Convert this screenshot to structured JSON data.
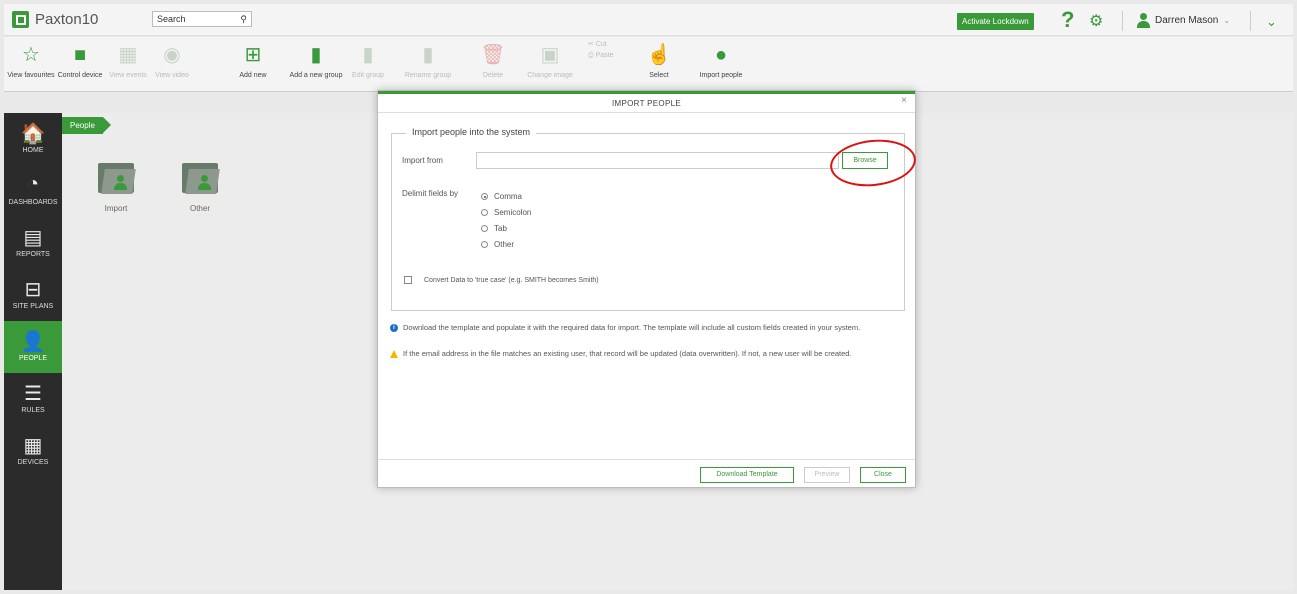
{
  "app": {
    "title": "Paxton10",
    "brand_color": "#3a9a3a"
  },
  "header": {
    "search_label": "Search",
    "search_icon": "magnifier-icon",
    "lockdown_label": "Activate Lockdown",
    "help_icon": "question-mark-icon",
    "settings_icon": "cog-icon",
    "user_name": "Darren Mason",
    "user_icon": "person-icon",
    "menu_icon": "chevron-down-icon"
  },
  "toolbar": {
    "view_favourites": "View favourites",
    "control_device": "Control device",
    "view_events": "View events",
    "view_video": "View video",
    "add_new": "Add new",
    "add_new_group": "Add a new group",
    "edit_group": "Edit group",
    "rename_group": "Rename group",
    "delete": "Delete",
    "change_image": "Change image",
    "cut": "Cut",
    "paste": "Paste",
    "select": "Select",
    "import_people": "Import people"
  },
  "sidebar": {
    "items": [
      {
        "label": "HOME",
        "icon": "home-icon",
        "glyph": "🏠"
      },
      {
        "label": "DASHBOARDS",
        "icon": "gauge-icon",
        "glyph": "◔"
      },
      {
        "label": "REPORTS",
        "icon": "report-icon",
        "glyph": "▤"
      },
      {
        "label": "SITE PLANS",
        "icon": "floorplan-icon",
        "glyph": "⊟"
      },
      {
        "label": "PEOPLE",
        "icon": "person-icon",
        "glyph": "👤"
      },
      {
        "label": "RULES",
        "icon": "list-icon",
        "glyph": "☰"
      },
      {
        "label": "DEVICES",
        "icon": "devices-icon",
        "glyph": "▦"
      }
    ],
    "active": "PEOPLE"
  },
  "content": {
    "breadcrumb": "People",
    "folders": [
      {
        "label": "Import"
      },
      {
        "label": "Other"
      }
    ]
  },
  "modal": {
    "title": "IMPORT PEOPLE",
    "close_glyph": "×",
    "legend": "Import people into the system",
    "import_from_label": "Import from",
    "import_from_value": "",
    "browse_label": "Browse",
    "delimit_label": "Delimit fields by",
    "delimiters": [
      {
        "label": "Comma",
        "selected": true
      },
      {
        "label": "Semicolon",
        "selected": false
      },
      {
        "label": "Tab",
        "selected": false
      },
      {
        "label": "Other",
        "selected": false
      }
    ],
    "convert_label": "Convert Data to 'true case' (e.g. SMITH becomes Smith)",
    "convert_checked": false,
    "info_note": "Download the template and populate it with the required data for import. The template will include all custom fields created in your system.",
    "warning_note": "If the email address in the file matches an existing user, that record will be updated (data overwritten). If not, a new user will be created.",
    "buttons": {
      "download_template": "Download Template",
      "preview": "Preview",
      "close": "Close"
    }
  }
}
